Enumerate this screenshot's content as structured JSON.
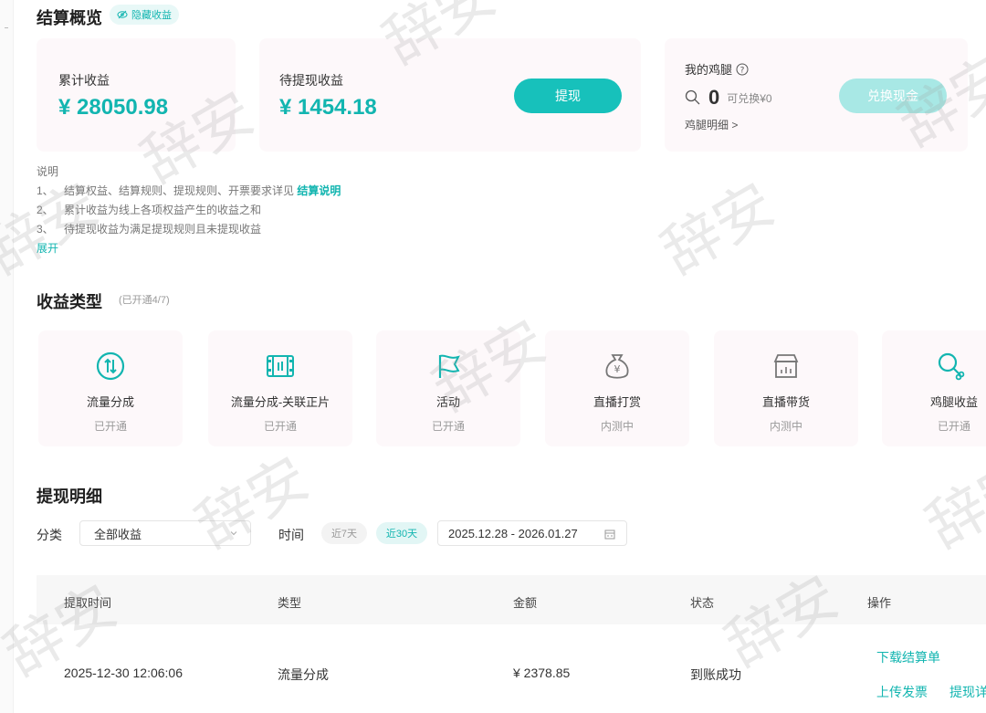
{
  "overview": {
    "title": "结算概览",
    "hide_label": "隐藏收益",
    "total": {
      "label": "累计收益",
      "amount": "¥ 28050.98"
    },
    "pending": {
      "label": "待提现收益",
      "amount": "¥ 1454.18",
      "button": "提现"
    },
    "drumstick": {
      "label": "我的鸡腿",
      "count": "0",
      "exchangeable": "可兑换¥0",
      "detail_link": "鸡腿明细 >",
      "button": "兑换现金"
    }
  },
  "notes": {
    "heading": "说明",
    "items": [
      {
        "num": "1、",
        "text": "结算权益、结算规则、提现规则、开票要求详见",
        "link": "结算说明"
      },
      {
        "num": "2、",
        "text": "累计收益为线上各项权益产生的收益之和"
      },
      {
        "num": "3、",
        "text": "待提现收益为满足提现规则且未提现收益"
      }
    ],
    "expand": "展开"
  },
  "types": {
    "title": "收益类型",
    "count": "(已开通4/7)",
    "items": [
      {
        "name": "流量分成",
        "status": "已开通",
        "icon": "traffic-share-icon"
      },
      {
        "name": "流量分成-关联正片",
        "status": "已开通",
        "icon": "film-strip-icon"
      },
      {
        "name": "活动",
        "status": "已开通",
        "icon": "flag-icon"
      },
      {
        "name": "直播打赏",
        "status": "内测中",
        "icon": "money-bag-icon"
      },
      {
        "name": "直播带货",
        "status": "内测中",
        "icon": "shop-icon"
      },
      {
        "name": "鸡腿收益",
        "status": "已开通",
        "icon": "drumstick-icon"
      }
    ]
  },
  "withdraw": {
    "title": "提现明细",
    "category_label": "分类",
    "category_value": "全部收益",
    "time_label": "时间",
    "range_7": "近7天",
    "range_30": "近30天",
    "date_range": "2025.12.28 - 2026.01.27",
    "columns": [
      "提取时间",
      "类型",
      "金额",
      "状态",
      "操作"
    ],
    "rows": [
      {
        "time": "2025-12-30 12:06:06",
        "type": "流量分成",
        "amount": "¥ 2378.85",
        "status": "到账成功",
        "op_download": "下载结算单",
        "op_upload": "上传发票",
        "op_detail": "提现详"
      }
    ]
  },
  "watermark_text": "辞安",
  "colors": {
    "accent": "#12b5b0",
    "button": "#17c1bb",
    "card_bg": "#fdf8fa"
  }
}
